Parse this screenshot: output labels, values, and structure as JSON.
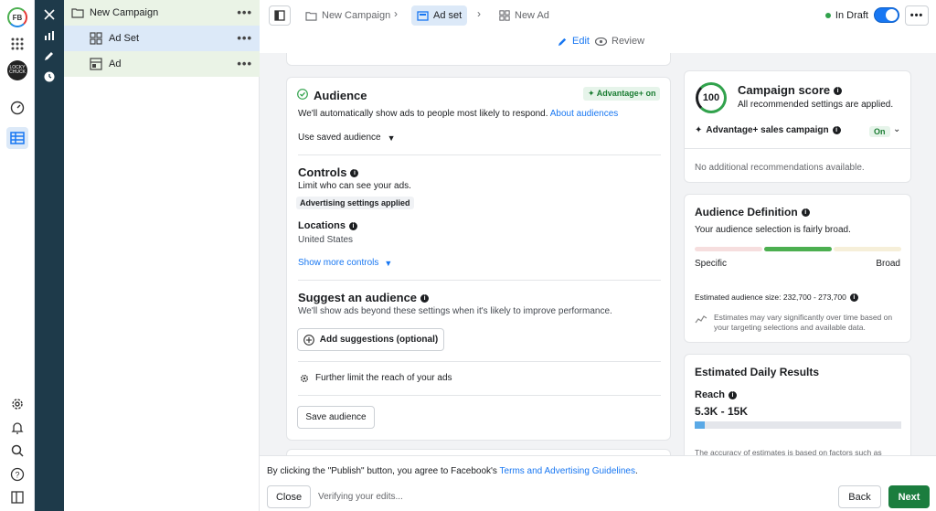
{
  "rail": {
    "logo": "FB",
    "avatar_text": "LOCKY CHUCK",
    "icons": [
      "apps-grid-icon",
      "gauge-icon",
      "table-icon",
      "gear-icon",
      "bell-icon",
      "search-icon",
      "help-icon",
      "panel-icon"
    ]
  },
  "tree": {
    "campaign": "New Campaign",
    "adset": "Ad Set",
    "ad": "Ad",
    "more": "•••"
  },
  "topbar": {
    "crumb_campaign": "New Campaign",
    "crumb_adset": "Ad set",
    "crumb_ad": "New Ad",
    "status": "In Draft",
    "more": "•••",
    "edit": "Edit",
    "review": "Review"
  },
  "audience": {
    "title": "Audience",
    "badge": "Advantage+ on",
    "desc": "We'll automatically show ads to people most likely to respond.",
    "desc_link": "About audiences",
    "saved": "Use saved audience",
    "controls_title": "Controls",
    "controls_desc": "Limit who can see your ads.",
    "settings_badge": "Advertising settings applied",
    "locations_label": "Locations",
    "locations_value": "United States",
    "show_more": "Show more controls",
    "suggest_title": "Suggest an audience",
    "suggest_desc": "We'll show ads beyond these settings when it's likely to improve performance.",
    "add_suggestions": "Add suggestions (optional)",
    "further_limit": "Further limit the reach of your ads",
    "save_audience": "Save audience"
  },
  "score": {
    "value": "100",
    "title": "Campaign score",
    "desc": "All recommended settings are applied.",
    "advantage": "Advantage+ sales campaign",
    "on": "On",
    "no_recs": "No additional recommendations available."
  },
  "definition": {
    "title": "Audience Definition",
    "desc": "Your audience selection is fairly broad.",
    "specific": "Specific",
    "broad": "Broad",
    "size": "Estimated audience size: 232,700 - 273,700",
    "note": "Estimates may vary significantly over time based on your targeting selections and available data."
  },
  "daily": {
    "title": "Estimated Daily Results",
    "reach_label": "Reach",
    "reach_value": "5.3K - 15K",
    "reach_fill": 0.05,
    "accuracy": "The accuracy of estimates is based on factors such as"
  },
  "footer": {
    "agree_prefix": "By clicking the \"Publish\" button, you agree to Facebook's",
    "agree_link": "Terms and Advertising Guidelines",
    "agree_suffix": ".",
    "close": "Close",
    "verifying": "Verifying your edits...",
    "back": "Back",
    "next": "Next"
  },
  "colors": {
    "accent": "#1877f2",
    "success": "#31a24c",
    "next_button": "#1b7d3e",
    "sidebar_dark": "#1e3a4a"
  }
}
